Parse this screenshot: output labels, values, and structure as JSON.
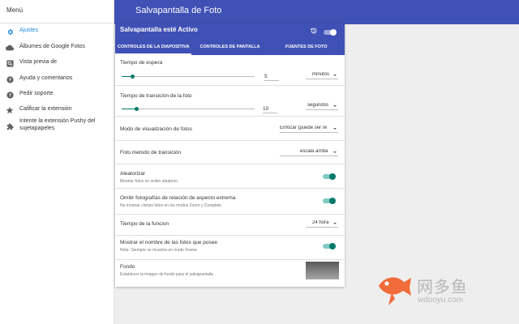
{
  "sidebar": {
    "title": "Menú",
    "items": [
      {
        "label": "Ajustes",
        "icon": "gear-icon"
      },
      {
        "label": "Álbumes de Google Fotos",
        "icon": "cloud-icon"
      },
      {
        "label": "Vista previa de",
        "icon": "search-icon"
      },
      {
        "label": "Ayuda y comentarios",
        "icon": "help-icon"
      },
      {
        "label": "Pedir soporte",
        "icon": "help-icon"
      },
      {
        "label": "Calificar la extensión",
        "icon": "star-icon"
      },
      {
        "label": "Intente la extensión Pushy del sujetapapeles",
        "icon": "puzzle-icon"
      }
    ]
  },
  "header": {
    "title": "Salvapantalla de Foto"
  },
  "card": {
    "status_title": "Salvapantalla esté Activo",
    "tabs": [
      "CONTROLES DE LA DIAPOSITIVA",
      "CONTROLES DE PANTALLA",
      "FUENTES DE FOTO"
    ],
    "wait_time": {
      "label": "Tiempo de espera",
      "value": "5",
      "unit": "minutos",
      "slider_fraction": 0.08
    },
    "transition_time": {
      "label": "Tiempo de transición de la foto",
      "value": "10",
      "unit": "segundos",
      "slider_fraction": 0.11
    },
    "display_mode": {
      "label": "Modo de visualización de fotos",
      "value": "Enfocar (puede ser re"
    },
    "transition_method": {
      "label": "Foto metodo de transición",
      "value": "escala arriba"
    },
    "randomize": {
      "label": "Aleatorizar",
      "sub": "Mostrar fotos en orden aleatorio"
    },
    "omit_extreme": {
      "label": "Omitir fotografías de relación de aspecto extrema",
      "sub": "No mostrar ciertas fotos en los modos Zoom y Completo"
    },
    "clock": {
      "label": "Tiempo de la funcion",
      "value": "24 hora"
    },
    "show_name": {
      "label": "Mostrar el nombre de las fotos que posee",
      "sub": "Nota: Siempre se muestra en modo Frame"
    },
    "background": {
      "label": "Fondo",
      "sub": "Establecer la imagen de fondo para el salvapantalla"
    }
  },
  "watermark": {
    "text": "网多鱼",
    "url": "wduoyu.com"
  },
  "colors": {
    "primary": "#3f51b5",
    "accent": "#00796b",
    "active_nav": "#1e88e5",
    "watermark_fish": "#f26b3a"
  }
}
